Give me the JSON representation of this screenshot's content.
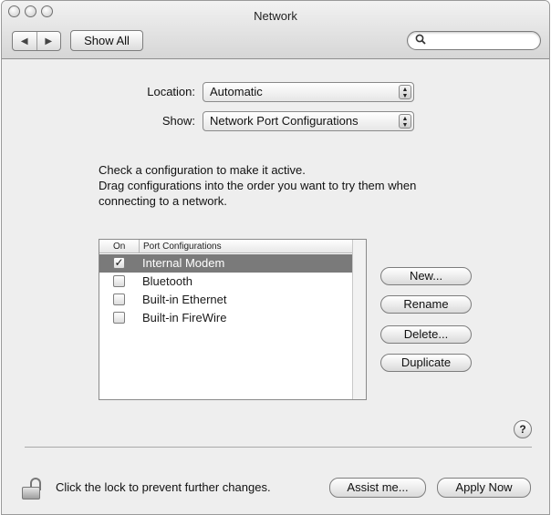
{
  "window": {
    "title": "Network",
    "show_all_label": "Show All",
    "nav_back_glyph": "◀",
    "nav_forward_glyph": "▶",
    "search_placeholder": "",
    "search_icon_glyph": "🔍"
  },
  "location": {
    "label": "Location:",
    "value": "Automatic"
  },
  "show": {
    "label": "Show:",
    "value": "Network Port Configurations"
  },
  "instructions": {
    "line1": "Check a configuration to make it active.",
    "line2": "Drag configurations into the order you want to try them when",
    "line3": "connecting to a network."
  },
  "port_list": {
    "columns": {
      "on": "On",
      "ports": "Port Configurations"
    },
    "rows": [
      {
        "label": "Internal Modem",
        "checked": true,
        "selected": true
      },
      {
        "label": "Bluetooth",
        "checked": false,
        "selected": false
      },
      {
        "label": "Built-in Ethernet",
        "checked": false,
        "selected": false
      },
      {
        "label": "Built-in FireWire",
        "checked": false,
        "selected": false
      }
    ]
  },
  "buttons": {
    "new": "New...",
    "rename": "Rename",
    "delete": "Delete...",
    "duplicate": "Duplicate",
    "help": "?",
    "assist": "Assist me...",
    "apply": "Apply Now"
  },
  "lock": {
    "text": "Click the lock to prevent further changes.",
    "icon": "lock-open-icon"
  },
  "checkmark_glyph": "✓",
  "popup_arrows_glyph": "▲▼"
}
